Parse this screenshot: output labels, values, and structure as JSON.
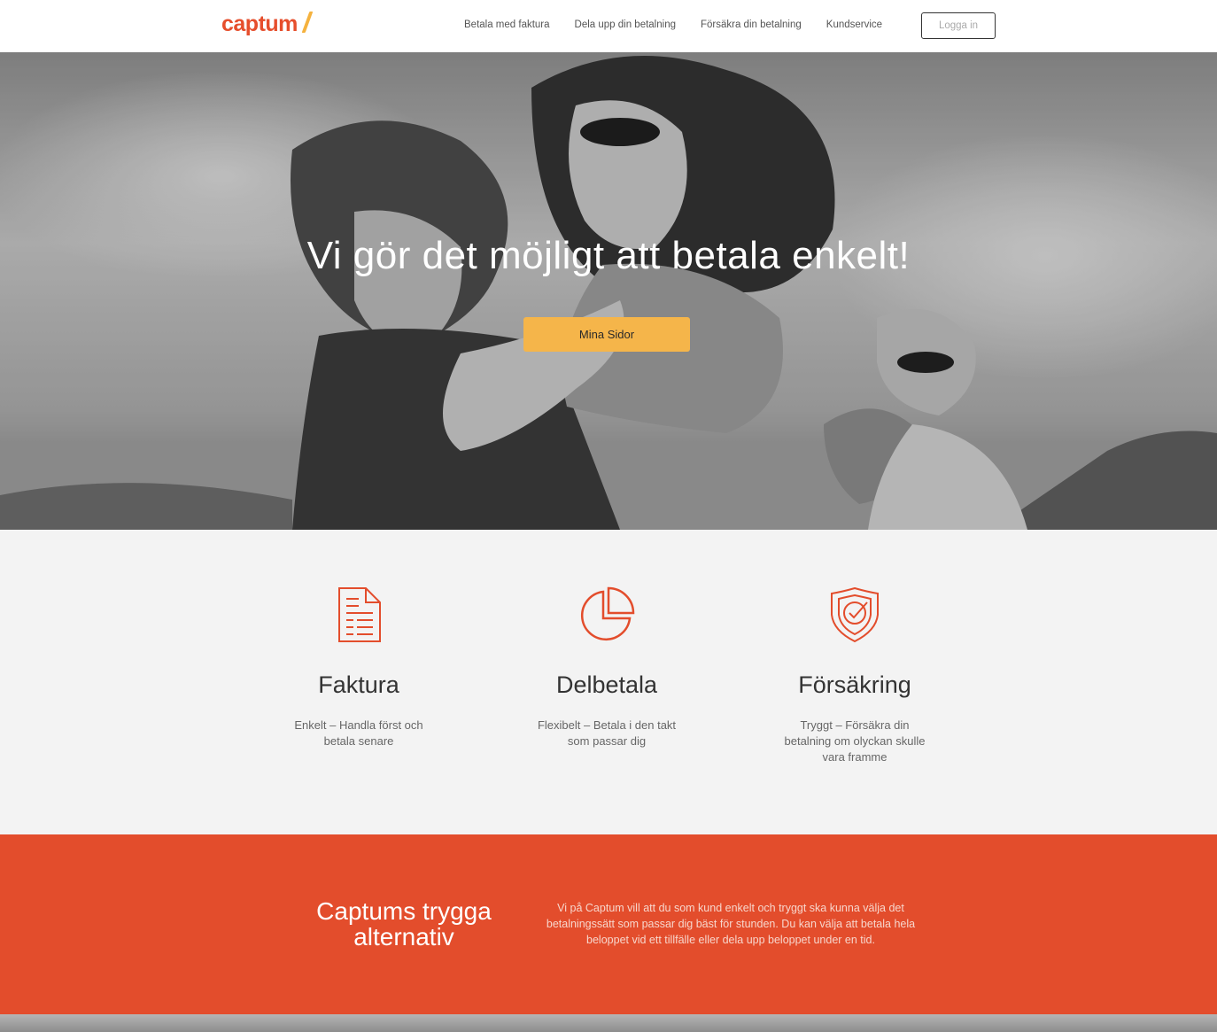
{
  "header": {
    "logo_text": "captum",
    "nav": [
      "Betala med faktura",
      "Dela upp din betalning",
      "Försäkra din betalning",
      "Kundservice"
    ],
    "login_label": "Logga in"
  },
  "hero": {
    "title": "Vi gör det möjligt att betala enkelt!",
    "button_label": "Mina Sidor"
  },
  "features": [
    {
      "icon": "invoice-document-icon",
      "title": "Faktura",
      "text": "Enkelt – Handla först och betala senare"
    },
    {
      "icon": "pie-chart-icon",
      "title": "Delbetala",
      "text": "Flexibelt – Betala i den takt som passar dig"
    },
    {
      "icon": "shield-check-icon",
      "title": "Försäkring",
      "text": "Tryggt – Försäkra din betalning om olyckan skulle vara framme"
    }
  ],
  "safe_section": {
    "title": "Captums trygga alternativ",
    "text": "Vi på Captum vill att du som kund enkelt och tryggt ska kunna välja det betalningssätt som passar dig bäst för stunden. Du kan välja att betala hela beloppet vid ett tillfälle eller dela upp beloppet under en tid."
  },
  "colors": {
    "brand_orange": "#e34d2c",
    "accent_yellow": "#f5b54a",
    "feature_bg": "#f3f3f3"
  }
}
